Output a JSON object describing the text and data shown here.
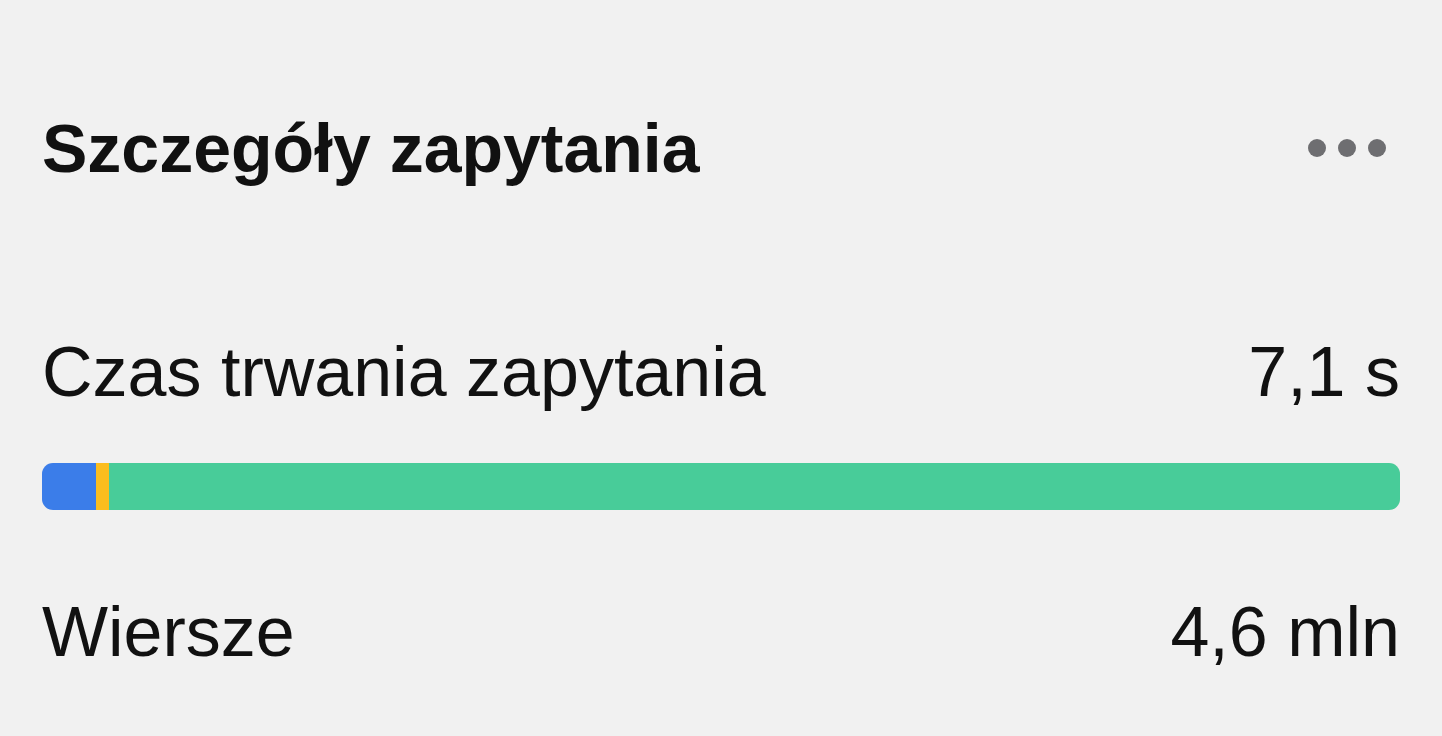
{
  "header": {
    "title": "Szczegóły zapytania"
  },
  "items": [
    {
      "kind": "stat",
      "label": "Czas trwania zapytania",
      "value": "7,1 s"
    },
    {
      "kind": "bar",
      "segments": [
        {
          "color": "#3b7de9",
          "level": 0.04
        },
        {
          "color": "#fbbd1e",
          "level": 0.009
        },
        {
          "color": "#48cc99",
          "level": 0.951
        }
      ]
    },
    {
      "kind": "stat",
      "label": "Wiersze",
      "value": "4,6 mln"
    }
  ]
}
